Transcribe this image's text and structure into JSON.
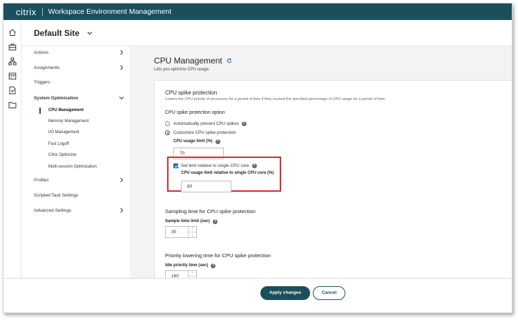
{
  "header": {
    "brand": "citrix",
    "product": "Workspace Environment Management"
  },
  "site": {
    "name": "Default Site"
  },
  "icon_rail": [
    "home-icon",
    "briefcase-icon",
    "network-icon",
    "calendar-icon",
    "report-icon",
    "folder-icon"
  ],
  "nav": {
    "actions": "Actions",
    "assignments": "Assignments",
    "triggers": "Triggers",
    "system_optimization": "System Optimization",
    "sub": {
      "cpu": "CPU Management",
      "memory": "Memory Management",
      "io": "I/O Management",
      "fastlogoff": "Fast Logoff",
      "citrix_optimizer": "Citrix Optimizer",
      "multisession": "Multi-session Optimization"
    },
    "profiles": "Profiles",
    "scripted": "Scripted Task Settings",
    "advanced": "Advanced Settings"
  },
  "page": {
    "title": "CPU Management",
    "subtitle": "Lets you optimize CPU usage."
  },
  "spike": {
    "title": "CPU spike protection",
    "desc": "Lowers the CPU priority of processes for a period of time if they exceed the specified percentage of CPU usage for a period of time.",
    "option_title": "CPU spike protection option",
    "radio_auto": "Automatically prevent CPU spikes",
    "radio_custom": "Customize CPU spike protection",
    "usage_label": "CPU usage limit (%)",
    "usage_value": "70",
    "single_core_label": "Set limit relative to single CPU core",
    "single_core_field_label": "CPU usage limit relative to single CPU core (%)",
    "single_core_value": "80"
  },
  "sampling": {
    "title": "Sampling time for CPU spike protection",
    "label": "Sample time limit (sec)",
    "value": "30"
  },
  "priority": {
    "title": "Priority lowering time for CPU spike protection",
    "label": "Idle priority time (sec)",
    "value": "180"
  },
  "footer": {
    "apply": "Apply changes",
    "cancel": "Cancel"
  },
  "colors": {
    "header": "#1b4f5c",
    "highlight": "#d8262b",
    "checkbox": "#1b6ea8"
  }
}
